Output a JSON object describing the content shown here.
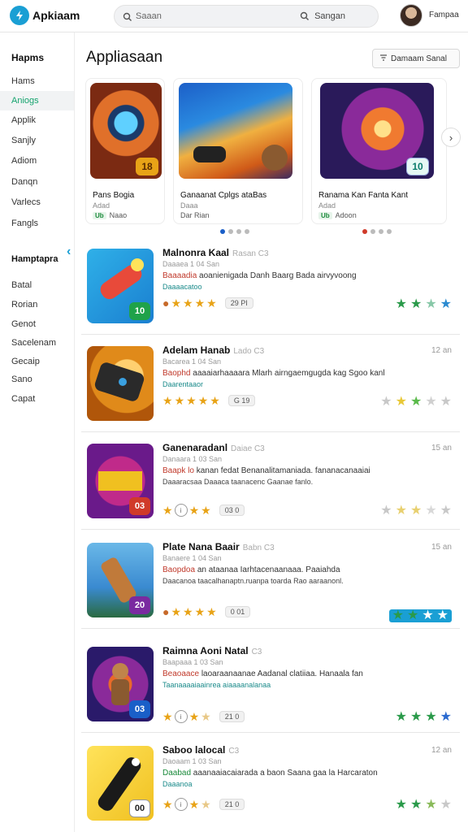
{
  "colors": {
    "accent": "#1a9fd4",
    "green": "#14a36d",
    "star": "#e8a317"
  },
  "header": {
    "logo_text": "Apkiaam",
    "search_placeholder": "Saaan",
    "search_right": "Sangan",
    "user_name": "Fampaa"
  },
  "sidebar": {
    "section1_title": "Hapms",
    "section1_items": [
      "Hams",
      "Aniogs",
      "Applik",
      "Sanjly",
      "Adiom",
      "Danqn",
      "Varlecs",
      "Fangls"
    ],
    "section2_title": "Hamptapra",
    "section2_items": [
      "Batal",
      "Rorian",
      "Genot",
      "Sacelenam",
      "Gecaip",
      "Sano",
      "Capat"
    ]
  },
  "main": {
    "title": "Appliasaan",
    "top_button": "Damaam Sanal"
  },
  "featured": [
    {
      "title": "Pans Bogia",
      "sub": "Adad",
      "tag": "Ub",
      "meta": "Naao",
      "badge": "18"
    },
    {
      "title": "Ganaanat Cplgs ataBas",
      "sub": "Daaa",
      "tag": "",
      "meta": "Dar Rian",
      "badge": ""
    },
    {
      "title": "Ranama Kan Fanta Kant",
      "sub": "Adad",
      "tag": "Ub",
      "meta": "Adoon",
      "badge": "10"
    }
  ],
  "rows": [
    {
      "title": "Malnonra Kaal",
      "extra": "Rasan C3",
      "time": "",
      "sub": "Daaaea 1 04  San",
      "desc_hl": "Baaaadia",
      "desc": " aoanienigada Danh Baarg Bada airvyvoong",
      "desc2": "Daaaacatoo",
      "badge": "10",
      "pill": "29 PI"
    },
    {
      "title": "Adelam Hanab",
      "extra": "Lado  C3",
      "time": "12 an",
      "sub": "Bacarea 1 04  San",
      "desc_hl": "Baophd",
      "desc": " aaaaiarhaaaara Mlarh airngaemgugda kag Sgoo kanl",
      "desc2": "Daarentaaor",
      "badge": "",
      "pill": "G 19"
    },
    {
      "title": "Ganenaradanl",
      "extra": "Daiae  C3",
      "time": "15 an",
      "sub": "Danaara 1 03  San",
      "desc_hl": "Baapk lo",
      "desc": " kanan fedat Benanalitamaniada. fananacanaaiai",
      "desc2": "Daaaracsaa  Daaaca taanacenc Gaanae fanlo.",
      "badge": "03",
      "pill": "03 0"
    },
    {
      "title": "Plate Nana Baair",
      "extra": "Babn C3",
      "time": "15 an",
      "sub": "Banaere 1 04  San",
      "desc_hl": "Baopdoa",
      "desc": " an ataanaa Iarhtacenaanaaa. Paaiahda",
      "desc2": "Daacanoa taacalhanaptn.ruanpa toarda Rao aaraanonl.",
      "badge": "20",
      "pill": "0 01"
    },
    {
      "title": "Raimna Aoni Natal",
      "extra": "C3",
      "time": "",
      "sub": "Baapaaa 1 03  San",
      "desc_hl": "Beaoaace",
      "desc": " laoaraanaanae Aadanal clatiiaa. Hanaala fan",
      "desc2": "Taanaaaaiaainrea aiaaaanalanaa",
      "badge": "03",
      "pill": "21 0"
    },
    {
      "title": "Saboo lalocal",
      "extra": "C3",
      "time": "12 an",
      "sub": "Daoaam 1 03  San",
      "desc_hl": "Daabad",
      "desc": " aaanaaiacaiarada a baon Saana gaa la Harcaraton",
      "desc2": "Daaanoa",
      "badge": "00",
      "pill": "21 0"
    }
  ]
}
